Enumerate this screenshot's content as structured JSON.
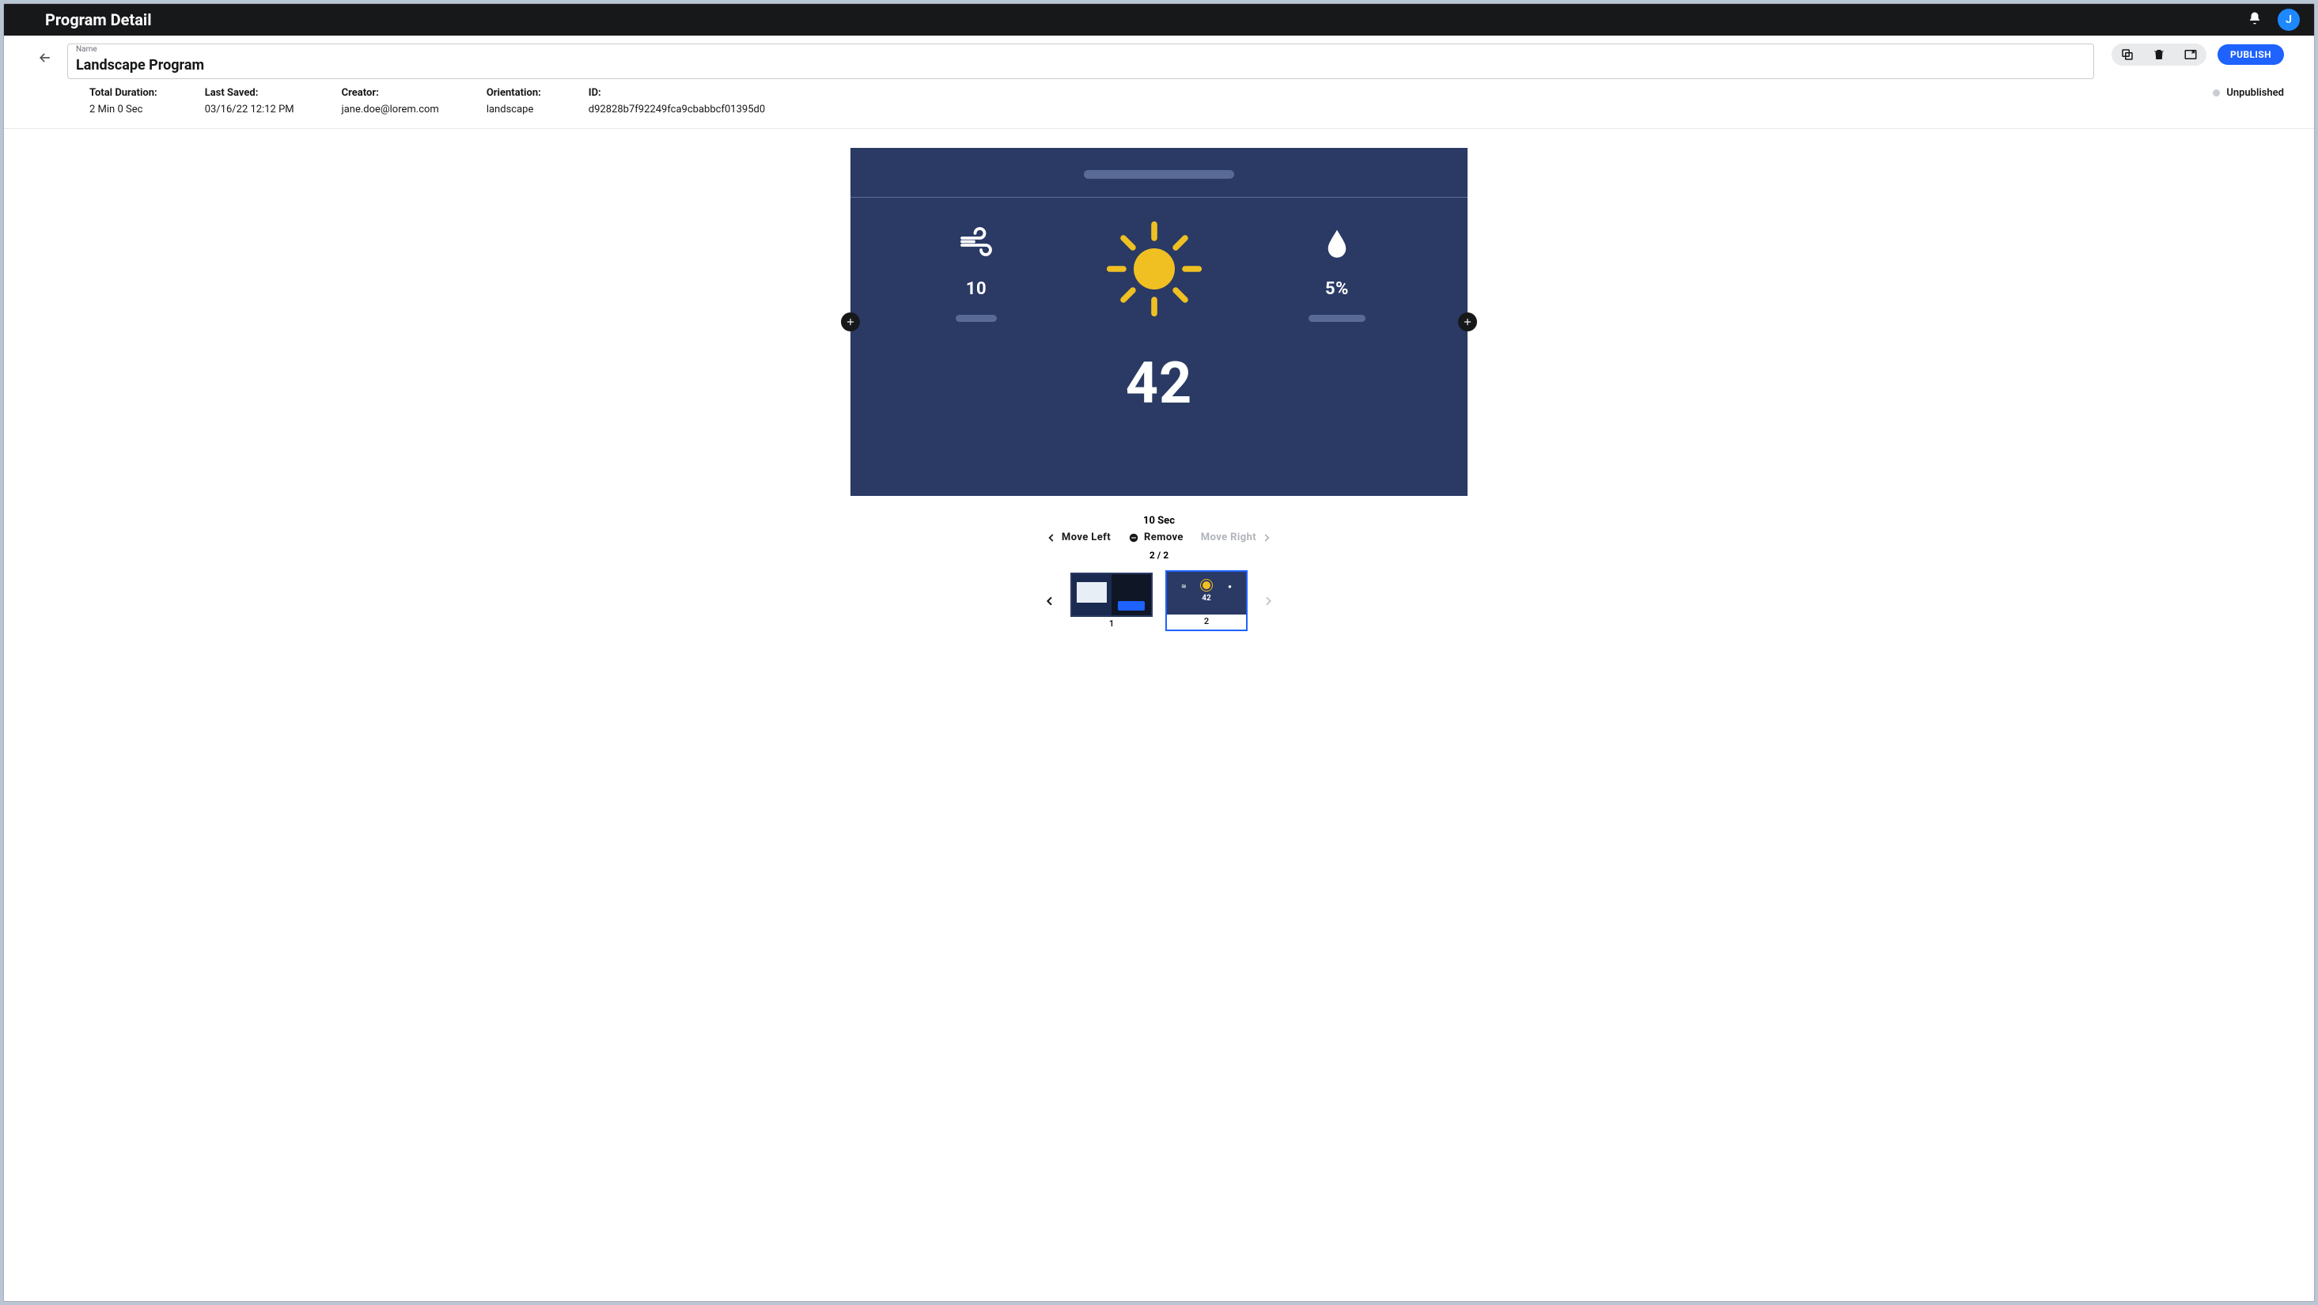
{
  "appbar": {
    "title": "Program Detail",
    "avatar_initial": "J"
  },
  "name_field": {
    "label": "Name",
    "value": "Landscape Program"
  },
  "actions": {
    "publish_label": "PUBLISH"
  },
  "meta": {
    "duration": {
      "label": "Total Duration:",
      "value": "2 Min 0 Sec"
    },
    "last_saved": {
      "label": "Last Saved:",
      "value": "03/16/22 12:12 PM"
    },
    "creator": {
      "label": "Creator:",
      "value": "jane.doe@lorem.com"
    },
    "orientation": {
      "label": "Orientation:",
      "value": "landscape"
    },
    "id": {
      "label": "ID:",
      "value": "d92828b7f92249fca9cbabbcf01395d0"
    },
    "status": "Unpublished"
  },
  "slide": {
    "wind_value": "10",
    "humidity_value": "5%",
    "temp": "42"
  },
  "under": {
    "seconds": "10 Sec",
    "move_left": "Move Left",
    "remove": "Remove",
    "move_right": "Move Right",
    "counter": "2 / 2"
  },
  "thumbs": {
    "t1_label": "1",
    "t2_label": "2",
    "t2_temp": "42"
  }
}
